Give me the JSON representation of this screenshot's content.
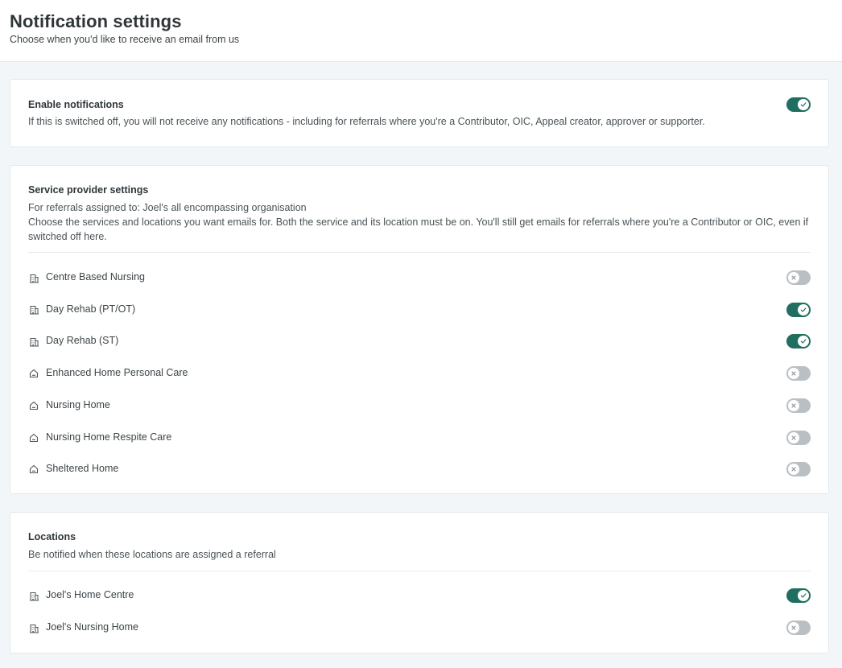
{
  "header": {
    "title": "Notification settings",
    "subtitle": "Choose when you'd like to receive an email from us"
  },
  "enable": {
    "title": "Enable notifications",
    "description": "If this is switched off, you will not receive any notifications - including for referrals where you're a Contributor, OIC, Appeal creator, approver or supporter.",
    "enabled": true
  },
  "services": {
    "title": "Service provider settings",
    "assigned_to": "For referrals assigned to: Joel's all encompassing organisation",
    "description": "Choose the services and locations you want emails for. Both the service and its location must be on. You'll still get emails for referrals where you're a Contributor or OIC, even if switched off here.",
    "items": [
      {
        "label": "Centre Based Nursing",
        "icon": "building-icon",
        "enabled": false
      },
      {
        "label": "Day Rehab (PT/OT)",
        "icon": "building-icon",
        "enabled": true
      },
      {
        "label": "Day Rehab (ST)",
        "icon": "building-icon",
        "enabled": true
      },
      {
        "label": "Enhanced Home Personal Care",
        "icon": "home-icon",
        "enabled": false
      },
      {
        "label": "Nursing Home",
        "icon": "home-icon",
        "enabled": false
      },
      {
        "label": "Nursing Home Respite Care",
        "icon": "home-icon",
        "enabled": false
      },
      {
        "label": "Sheltered Home",
        "icon": "home-icon",
        "enabled": false
      }
    ]
  },
  "locations": {
    "title": "Locations",
    "description": "Be notified when these locations are assigned a referral",
    "items": [
      {
        "label": "Joel's Home Centre",
        "icon": "building-icon",
        "enabled": true
      },
      {
        "label": "Joel's Nursing Home",
        "icon": "building-icon",
        "enabled": false
      }
    ]
  },
  "colors": {
    "toggle_on": "#1f6e5f",
    "toggle_off": "#b9bfc3",
    "page_background": "#f2f6f9"
  }
}
